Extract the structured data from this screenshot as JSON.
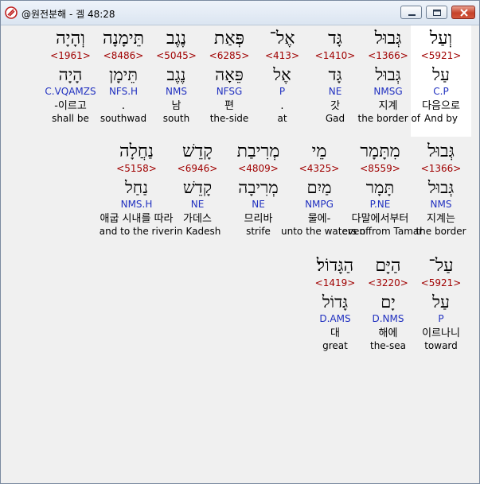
{
  "window": {
    "title": "@원전분해 - 겔 48:28"
  },
  "rows": [
    [
      {
        "heb": "וְעַל",
        "strong": "<5921>",
        "lex": "עַל",
        "morph": "C.P",
        "kor": "다음으로",
        "eng": "And by",
        "selected": true
      },
      {
        "heb": "גְּבוּל",
        "strong": "<1366>",
        "lex": "גְּבוּל",
        "morph": "NMSG",
        "kor": "지계",
        "eng": "the border of"
      },
      {
        "heb": "גָּד",
        "strong": "<1410>",
        "lex": "גָּד",
        "morph": "NE",
        "kor": "갓",
        "eng": "Gad"
      },
      {
        "heb": "אֶל־",
        "strong": "<413>",
        "lex": "אֶל",
        "morph": "P",
        "kor": ".",
        "eng": "at"
      },
      {
        "heb": "פְּאַת",
        "strong": "<6285>",
        "lex": "פֵּאָה",
        "morph": "NFSG",
        "kor": "편",
        "eng": "the-side"
      },
      {
        "heb": "נֶגֶב",
        "strong": "<5045>",
        "lex": "נֶגֶב",
        "morph": "NMS",
        "kor": "남",
        "eng": "south"
      },
      {
        "heb": "תֵּימָנָה",
        "strong": "<8486>",
        "lex": "תֵּימָן",
        "morph": "NFS.H",
        "kor": ".",
        "eng": "southwad"
      },
      {
        "heb": "וְהָיָה",
        "strong": "<1961>",
        "lex": "הָיָה",
        "morph": "C.VQAMZS",
        "kor": "-이르고",
        "eng": "shall be"
      }
    ],
    [
      {
        "heb": "גְּבוּל",
        "strong": "<1366>",
        "lex": "גְּבוּל",
        "morph": "NMS",
        "kor": "지계는",
        "eng": "the border"
      },
      {
        "heb": "מִתָּמָר",
        "strong": "<8559>",
        "lex": "תָּמָר",
        "morph": "P.NE",
        "kor": "다말에서부터",
        "eng": "even from Tamar"
      },
      {
        "heb": "מֵי",
        "strong": "<4325>",
        "lex": "מַיִם",
        "morph": "NMPG",
        "kor": "물에-",
        "eng": "unto the waters of"
      },
      {
        "heb": "מְרִיבַת",
        "strong": "<4809>",
        "lex": "מְרִיבָה",
        "morph": "NE",
        "kor": "므리바",
        "eng": "strife"
      },
      {
        "heb": "קָדֵשׁ",
        "strong": "<6946>",
        "lex": "קָדֵשׁ",
        "morph": "NE",
        "kor": "가데스",
        "eng": "in Kadesh"
      },
      {
        "heb": "נַחֲלָה",
        "strong": "<5158>",
        "lex": "נַחַל",
        "morph": "NMS.H",
        "kor": "애굽 시내를 따라",
        "eng": "and to the river"
      }
    ],
    [
      {
        "heb": "עַל־",
        "strong": "<5921>",
        "lex": "עַל",
        "morph": "P",
        "kor": "이르나니",
        "eng": "toward"
      },
      {
        "heb": "הַיָּם",
        "strong": "<3220>",
        "lex": "יָם",
        "morph": "D.NMS",
        "kor": "해에",
        "eng": "the-sea"
      },
      {
        "heb": "הַגָּדוֹל׃",
        "strong": "<1419>",
        "lex": "גָּדוֹל",
        "morph": "D.AMS",
        "kor": "대",
        "eng": "great"
      }
    ]
  ]
}
